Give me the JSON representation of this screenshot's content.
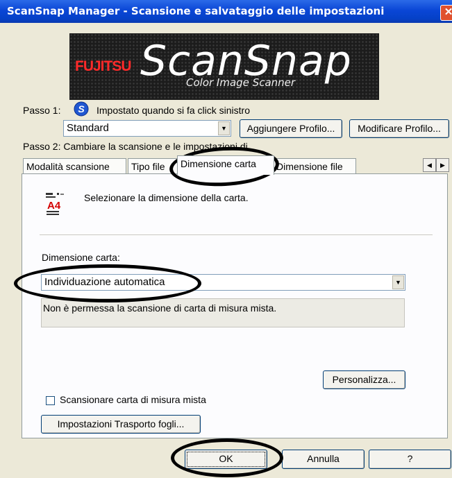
{
  "window": {
    "title": "ScanSnap Manager - Scansione e salvataggio delle impostazioni",
    "close_glyph": "✕"
  },
  "logo": {
    "brand": "FUJITSU",
    "product": "ScanSnap",
    "tagline": "Color Image Scanner"
  },
  "step1": {
    "label": "Passo 1:",
    "icon": "scansnap-s-icon",
    "description": "Impostato quando si fa click sinistro",
    "profile_value": "Standard",
    "add_profile": "Aggiungere Profilo...",
    "edit_profile": "Modificare Profilo..."
  },
  "step2": {
    "label": "Passo 2: Cambiare la scansione e le impostazioni di"
  },
  "tabs": [
    "Modalità scansione",
    "Tipo file",
    "Dimensione carta",
    "Dimensione file"
  ],
  "active_tab": "Dimensione carta",
  "panel": {
    "icon": "a4-paper-icon",
    "icon_text": "A4",
    "heading": "Selezionare la dimensione della carta.",
    "paper_size_label": "Dimensione carta:",
    "paper_size_value": "Individuazione automatica",
    "info_text": "Non è permessa la scansione di carta di misura mista.",
    "customize": "Personalizza...",
    "mixed_checkbox_label": "Scansionare carta di misura mista",
    "mixed_checked": false,
    "carrier_settings": "Impostazioni Trasporto fogli..."
  },
  "footer": {
    "ok": "OK",
    "cancel": "Annulla",
    "help": "?"
  }
}
